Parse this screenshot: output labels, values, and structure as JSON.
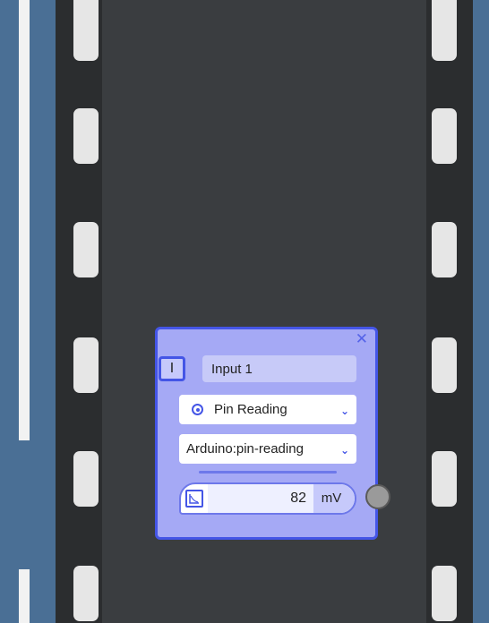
{
  "node": {
    "type_label": "I",
    "name_value": "Input 1",
    "close_glyph": "✕",
    "source_select": {
      "selected": "Pin Reading"
    },
    "channel_select": {
      "selected": "Arduino:pin-reading"
    },
    "reading": {
      "value": "82",
      "unit": "mV"
    },
    "chevron_glyph": "⌄"
  },
  "colors": {
    "canvas": "#3a3d40",
    "side_panel": "#4a6f95",
    "film_strip": "#2b2d2f",
    "node_fill": "#a5a9f5",
    "node_border": "#4455e6",
    "port": "#9a9a9a"
  },
  "icons": {
    "close": "close-icon",
    "source": "radio-target-icon",
    "graph": "graph-icon",
    "chevron": "chevron-down-icon"
  }
}
